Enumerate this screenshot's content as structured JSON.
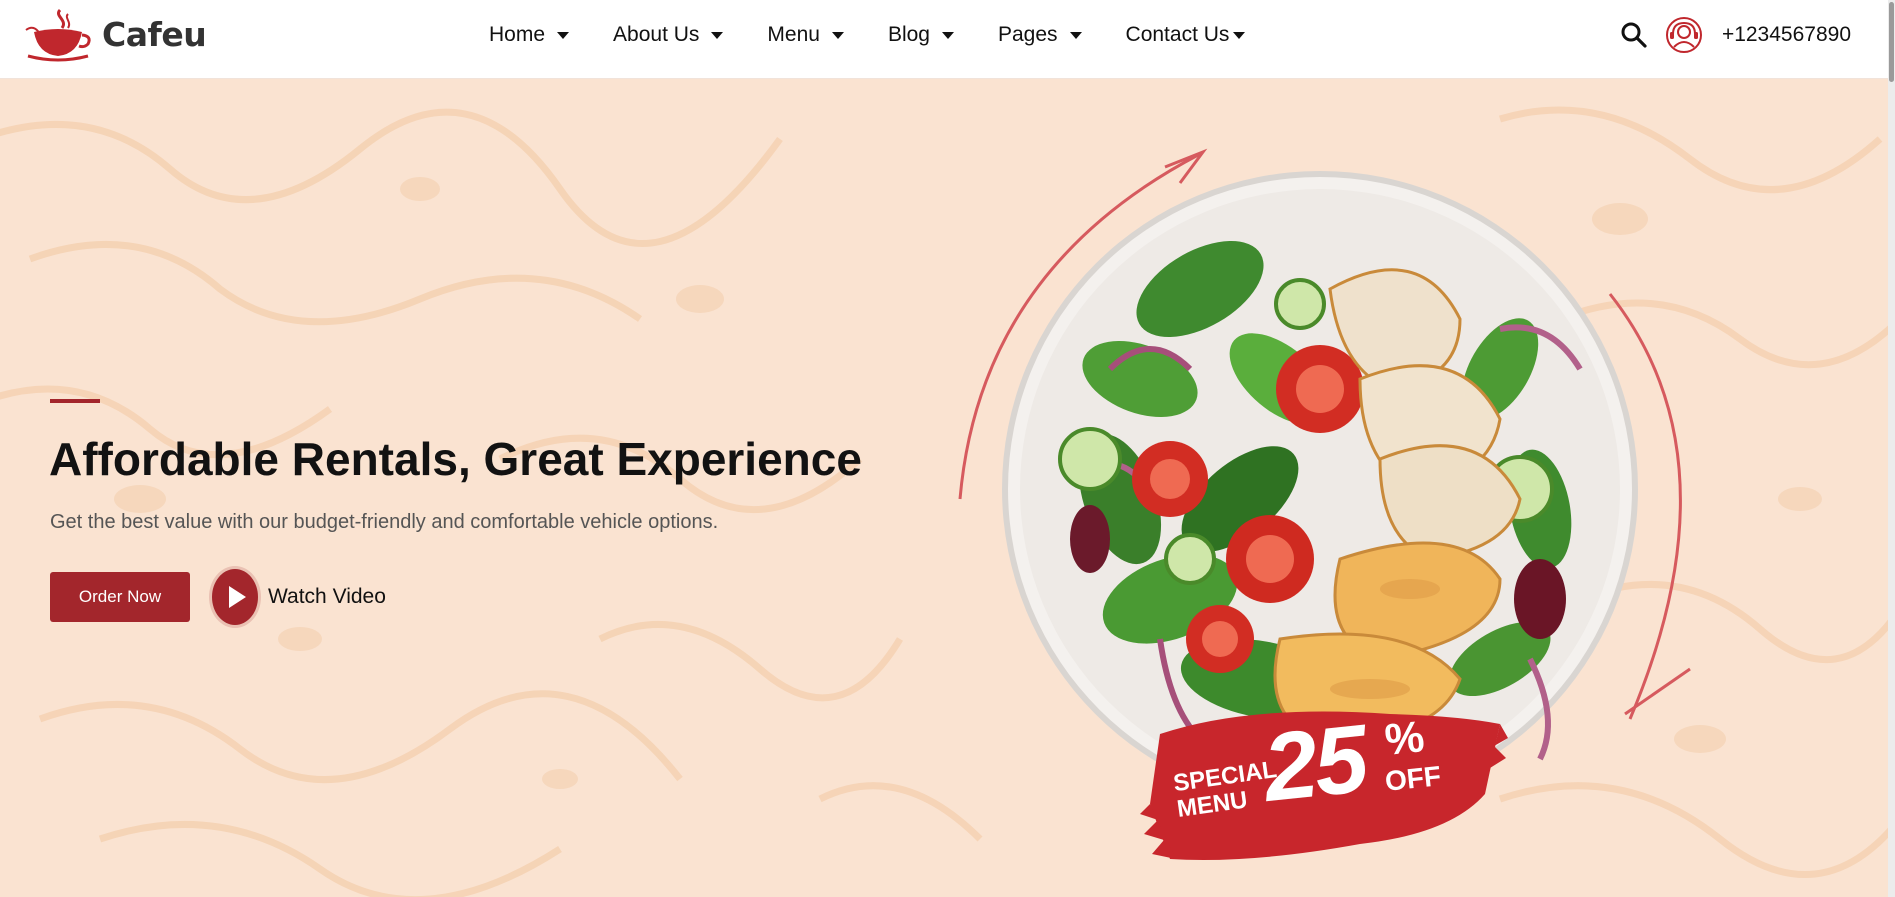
{
  "brand": {
    "name": "Cafeu",
    "logo_icon": "coffee-cup-logo-icon"
  },
  "nav": {
    "items": [
      {
        "label": "Home"
      },
      {
        "label": "About Us"
      },
      {
        "label": "Menu"
      },
      {
        "label": "Blog"
      },
      {
        "label": "Pages"
      },
      {
        "label": "Contact Us"
      }
    ]
  },
  "header": {
    "search_icon": "search-icon",
    "support_icon": "support-agent-icon",
    "phone": "+1234567890"
  },
  "hero": {
    "title": "Affordable Rentals, Great Experience",
    "subtitle": "Get the best value with our budget-friendly and comfortable vehicle options.",
    "order_button": "Order Now",
    "watch_label": "Watch Video"
  },
  "badge": {
    "line1": "SPECIAL",
    "line2": "MENU",
    "number": "25",
    "percent": "%",
    "off": "OFF"
  },
  "colors": {
    "accent": "#a3262c",
    "background": "#fbe6d6",
    "header_bg": "#ffffff"
  }
}
